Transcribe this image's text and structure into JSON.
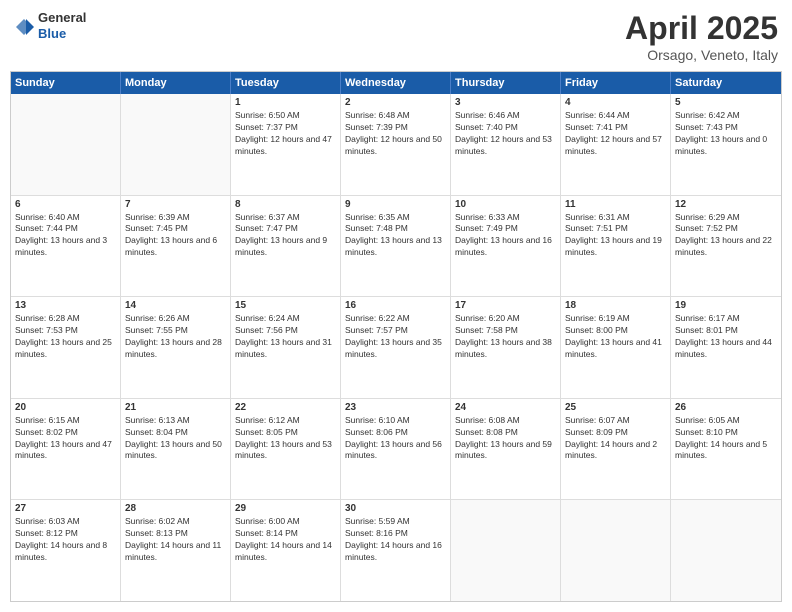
{
  "header": {
    "logo": {
      "general": "General",
      "blue": "Blue"
    },
    "title": "April 2025",
    "location": "Orsago, Veneto, Italy"
  },
  "days_of_week": [
    "Sunday",
    "Monday",
    "Tuesday",
    "Wednesday",
    "Thursday",
    "Friday",
    "Saturday"
  ],
  "rows": [
    [
      {
        "day": "",
        "empty": true
      },
      {
        "day": "",
        "empty": true
      },
      {
        "day": "1",
        "sunrise": "Sunrise: 6:50 AM",
        "sunset": "Sunset: 7:37 PM",
        "daylight": "Daylight: 12 hours and 47 minutes."
      },
      {
        "day": "2",
        "sunrise": "Sunrise: 6:48 AM",
        "sunset": "Sunset: 7:39 PM",
        "daylight": "Daylight: 12 hours and 50 minutes."
      },
      {
        "day": "3",
        "sunrise": "Sunrise: 6:46 AM",
        "sunset": "Sunset: 7:40 PM",
        "daylight": "Daylight: 12 hours and 53 minutes."
      },
      {
        "day": "4",
        "sunrise": "Sunrise: 6:44 AM",
        "sunset": "Sunset: 7:41 PM",
        "daylight": "Daylight: 12 hours and 57 minutes."
      },
      {
        "day": "5",
        "sunrise": "Sunrise: 6:42 AM",
        "sunset": "Sunset: 7:43 PM",
        "daylight": "Daylight: 13 hours and 0 minutes."
      }
    ],
    [
      {
        "day": "6",
        "sunrise": "Sunrise: 6:40 AM",
        "sunset": "Sunset: 7:44 PM",
        "daylight": "Daylight: 13 hours and 3 minutes."
      },
      {
        "day": "7",
        "sunrise": "Sunrise: 6:39 AM",
        "sunset": "Sunset: 7:45 PM",
        "daylight": "Daylight: 13 hours and 6 minutes."
      },
      {
        "day": "8",
        "sunrise": "Sunrise: 6:37 AM",
        "sunset": "Sunset: 7:47 PM",
        "daylight": "Daylight: 13 hours and 9 minutes."
      },
      {
        "day": "9",
        "sunrise": "Sunrise: 6:35 AM",
        "sunset": "Sunset: 7:48 PM",
        "daylight": "Daylight: 13 hours and 13 minutes."
      },
      {
        "day": "10",
        "sunrise": "Sunrise: 6:33 AM",
        "sunset": "Sunset: 7:49 PM",
        "daylight": "Daylight: 13 hours and 16 minutes."
      },
      {
        "day": "11",
        "sunrise": "Sunrise: 6:31 AM",
        "sunset": "Sunset: 7:51 PM",
        "daylight": "Daylight: 13 hours and 19 minutes."
      },
      {
        "day": "12",
        "sunrise": "Sunrise: 6:29 AM",
        "sunset": "Sunset: 7:52 PM",
        "daylight": "Daylight: 13 hours and 22 minutes."
      }
    ],
    [
      {
        "day": "13",
        "sunrise": "Sunrise: 6:28 AM",
        "sunset": "Sunset: 7:53 PM",
        "daylight": "Daylight: 13 hours and 25 minutes."
      },
      {
        "day": "14",
        "sunrise": "Sunrise: 6:26 AM",
        "sunset": "Sunset: 7:55 PM",
        "daylight": "Daylight: 13 hours and 28 minutes."
      },
      {
        "day": "15",
        "sunrise": "Sunrise: 6:24 AM",
        "sunset": "Sunset: 7:56 PM",
        "daylight": "Daylight: 13 hours and 31 minutes."
      },
      {
        "day": "16",
        "sunrise": "Sunrise: 6:22 AM",
        "sunset": "Sunset: 7:57 PM",
        "daylight": "Daylight: 13 hours and 35 minutes."
      },
      {
        "day": "17",
        "sunrise": "Sunrise: 6:20 AM",
        "sunset": "Sunset: 7:58 PM",
        "daylight": "Daylight: 13 hours and 38 minutes."
      },
      {
        "day": "18",
        "sunrise": "Sunrise: 6:19 AM",
        "sunset": "Sunset: 8:00 PM",
        "daylight": "Daylight: 13 hours and 41 minutes."
      },
      {
        "day": "19",
        "sunrise": "Sunrise: 6:17 AM",
        "sunset": "Sunset: 8:01 PM",
        "daylight": "Daylight: 13 hours and 44 minutes."
      }
    ],
    [
      {
        "day": "20",
        "sunrise": "Sunrise: 6:15 AM",
        "sunset": "Sunset: 8:02 PM",
        "daylight": "Daylight: 13 hours and 47 minutes."
      },
      {
        "day": "21",
        "sunrise": "Sunrise: 6:13 AM",
        "sunset": "Sunset: 8:04 PM",
        "daylight": "Daylight: 13 hours and 50 minutes."
      },
      {
        "day": "22",
        "sunrise": "Sunrise: 6:12 AM",
        "sunset": "Sunset: 8:05 PM",
        "daylight": "Daylight: 13 hours and 53 minutes."
      },
      {
        "day": "23",
        "sunrise": "Sunrise: 6:10 AM",
        "sunset": "Sunset: 8:06 PM",
        "daylight": "Daylight: 13 hours and 56 minutes."
      },
      {
        "day": "24",
        "sunrise": "Sunrise: 6:08 AM",
        "sunset": "Sunset: 8:08 PM",
        "daylight": "Daylight: 13 hours and 59 minutes."
      },
      {
        "day": "25",
        "sunrise": "Sunrise: 6:07 AM",
        "sunset": "Sunset: 8:09 PM",
        "daylight": "Daylight: 14 hours and 2 minutes."
      },
      {
        "day": "26",
        "sunrise": "Sunrise: 6:05 AM",
        "sunset": "Sunset: 8:10 PM",
        "daylight": "Daylight: 14 hours and 5 minutes."
      }
    ],
    [
      {
        "day": "27",
        "sunrise": "Sunrise: 6:03 AM",
        "sunset": "Sunset: 8:12 PM",
        "daylight": "Daylight: 14 hours and 8 minutes."
      },
      {
        "day": "28",
        "sunrise": "Sunrise: 6:02 AM",
        "sunset": "Sunset: 8:13 PM",
        "daylight": "Daylight: 14 hours and 11 minutes."
      },
      {
        "day": "29",
        "sunrise": "Sunrise: 6:00 AM",
        "sunset": "Sunset: 8:14 PM",
        "daylight": "Daylight: 14 hours and 14 minutes."
      },
      {
        "day": "30",
        "sunrise": "Sunrise: 5:59 AM",
        "sunset": "Sunset: 8:16 PM",
        "daylight": "Daylight: 14 hours and 16 minutes."
      },
      {
        "day": "",
        "empty": true
      },
      {
        "day": "",
        "empty": true
      },
      {
        "day": "",
        "empty": true
      }
    ]
  ]
}
